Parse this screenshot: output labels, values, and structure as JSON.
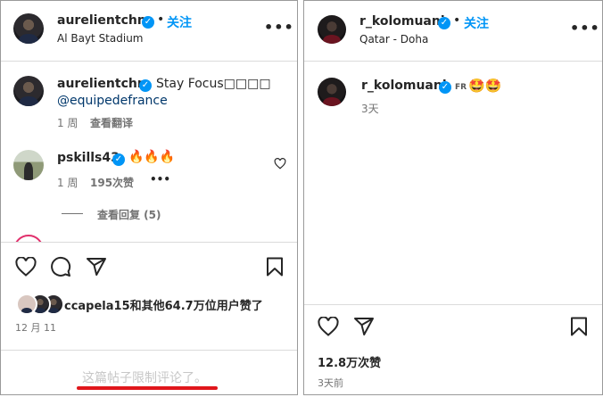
{
  "left": {
    "header": {
      "username": "aurelientchm",
      "follow_label": "关注",
      "location": "Al Bayt Stadium",
      "more": "•••"
    },
    "caption": {
      "username": "aurelientchm",
      "text": "Stay Focus□□□□",
      "mention": "@equipedefrance",
      "time": "1 周",
      "translate": "查看翻译"
    },
    "comment": {
      "username": "pskills43",
      "text": "🔥🔥🔥",
      "time": "1 周",
      "likes": "195次赞",
      "more": "•••",
      "view_replies": "查看回复 (5)"
    },
    "likes_text": "ccapela15和其他64.7万位用户赞了",
    "date": "12 月 11",
    "comments_limited": "这篇帖子限制评论了。"
  },
  "right": {
    "header": {
      "username": "r_kolomuani",
      "follow_label": "关注",
      "location": "Qatar - Doha",
      "more": "•••"
    },
    "caption": {
      "username": "r_kolomuani",
      "flag": "FR",
      "emoji": "🤩🤩",
      "time": "3天"
    },
    "likes_text": "12.8万次赞",
    "date": "3天前"
  },
  "colors": {
    "accent": "#0095f6",
    "highlight": "#e0161b",
    "muted": "#737373"
  },
  "icons": [
    "heart-icon",
    "comment-icon",
    "share-icon",
    "bookmark-icon",
    "verified-icon",
    "more-icon"
  ]
}
